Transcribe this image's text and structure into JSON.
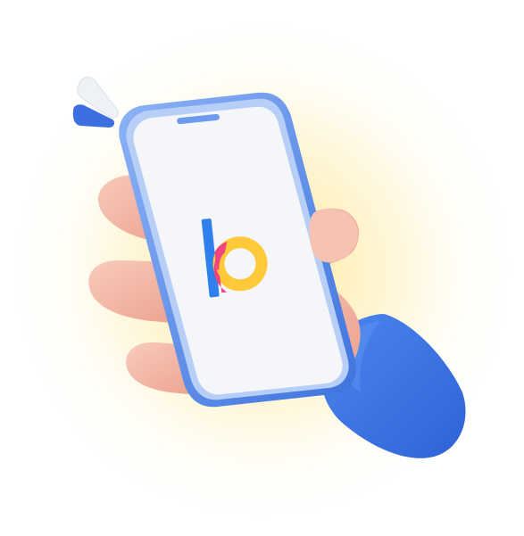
{
  "illustration": {
    "subject": "hand-holding-phone",
    "app_logo": "b-logo",
    "colors": {
      "glow": "#FFE27A",
      "phone_frame": "#5B8FEA",
      "phone_screen": "#F4F6F9",
      "speaker": "#6F9BEF",
      "sleeve": "#3B74E2",
      "skin": "#F4B9A8",
      "logo_blue": "#2F80ED",
      "logo_pink": "#F0447E",
      "logo_yellow": "#FFC93A",
      "accent_white": "#F2F4F8",
      "accent_blue": "#3B6FE0"
    }
  }
}
